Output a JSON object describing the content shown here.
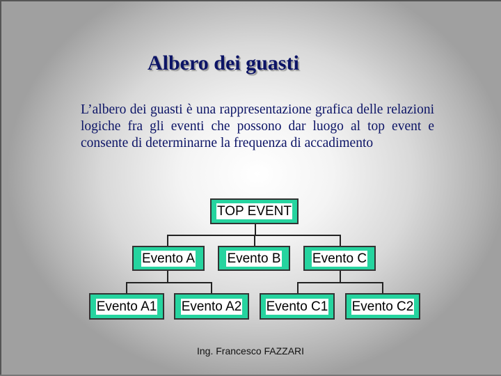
{
  "slide": {
    "title": "Albero dei guasti",
    "paragraph": "L’albero dei guasti è una rappresentazione grafica delle relazioni logiche fra gli eventi che possono dar luogo al top event e consente di determinarne la frequenza di accadimento",
    "footer": "Ing. Francesco FAZZARI"
  },
  "tree": {
    "top": "TOP EVENT",
    "level1": [
      "Evento A",
      "Evento B",
      "Evento C"
    ],
    "level2": [
      "Evento A1",
      "Evento A2",
      "Evento C1",
      "Evento C2"
    ],
    "box_color": "#26d49f",
    "text_color": "#0c1466"
  }
}
